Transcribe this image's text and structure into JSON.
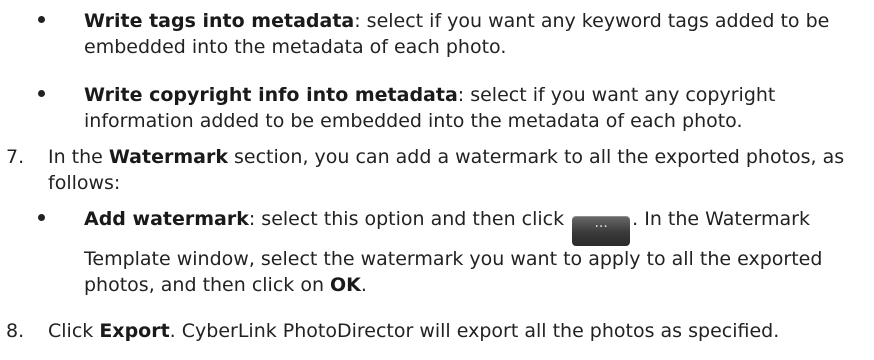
{
  "items": [
    {
      "kind": "bullet",
      "bold": "Write tags into metadata",
      "rest": ": select if you want any keyword tags added to be embedded into the metadata of each photo."
    },
    {
      "kind": "bullet",
      "bold": "Write copyright info into metadata",
      "rest": ": select if you want any copyright information added to be embedded into the metadata of each photo."
    },
    {
      "kind": "step",
      "number": "7.",
      "pre": "In the ",
      "bold": "Watermark",
      "rest": " section, you can add a watermark to all the exported photos, as follows:"
    },
    {
      "kind": "bullet",
      "bold": "Add watermark",
      "pre_button": ": select this option and then click ",
      "button_label": "···",
      "post_button": ". In the Watermark Template window, select the watermark you want to apply to all the exported photos, and then click on ",
      "bold_end": "OK",
      "end": "."
    },
    {
      "kind": "step",
      "number": "8.",
      "pre": "Click ",
      "bold": "Export",
      "rest": ". CyberLink PhotoDirector will export all the photos as specified."
    }
  ]
}
